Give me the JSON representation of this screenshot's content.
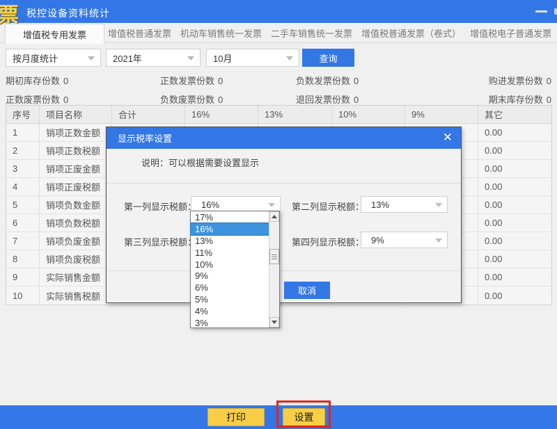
{
  "window": {
    "logo": "票",
    "title": "税控设备资料统计"
  },
  "tabs": {
    "active": "增值税专用发票",
    "items": [
      {
        "label": "增值税普通发票"
      },
      {
        "label": "机动车销售统一发票"
      },
      {
        "label": "二手车销售统一发票"
      },
      {
        "label": "增值税普通发票（卷式）"
      },
      {
        "label": "增值税电子普通发票"
      }
    ]
  },
  "filters": {
    "period": "按月度统计",
    "year": "2021年",
    "month": "10月",
    "query_label": "查询"
  },
  "stats": [
    {
      "label": "期初库存份数",
      "value": "0"
    },
    {
      "label": "正数发票份数",
      "value": "0"
    },
    {
      "label": "负数发票份数",
      "value": "0"
    },
    {
      "label": "购进发票份数",
      "value": "0"
    },
    {
      "label": "正数废票份数",
      "value": "0"
    },
    {
      "label": "负数废票份数",
      "value": "0"
    },
    {
      "label": "退回发票份数",
      "value": "0"
    },
    {
      "label": "期末库存份数",
      "value": "0"
    }
  ],
  "table": {
    "headers": [
      "序号",
      "项目名称",
      "合计",
      "16%",
      "13%",
      "10%",
      "9%",
      "其它"
    ],
    "rows": [
      {
        "no": "1",
        "name": "销项正数金额",
        "other": "0.00"
      },
      {
        "no": "2",
        "name": "销项正数税额",
        "other": "0.00"
      },
      {
        "no": "3",
        "name": "销项正废金额",
        "other": "0.00"
      },
      {
        "no": "4",
        "name": "销项正废税额",
        "other": "0.00"
      },
      {
        "no": "5",
        "name": "销项负数金额",
        "other": "0.00"
      },
      {
        "no": "6",
        "name": "销项负数税额",
        "other": "0.00"
      },
      {
        "no": "7",
        "name": "销项负废金额",
        "other": "0.00"
      },
      {
        "no": "8",
        "name": "销项负废税额",
        "other": "0.00"
      },
      {
        "no": "9",
        "name": "实际销售金额",
        "other": "0.00"
      },
      {
        "no": "10",
        "name": "实际销售税额",
        "other": "0.00"
      }
    ]
  },
  "modal": {
    "title": "显示税率设置",
    "close": "✕",
    "note": "说明：可以根据需要设置显示",
    "field1_label": "第一列显示税额：",
    "field1_value": "16%",
    "field2_label": "第二列显示税额：",
    "field2_value": "13%",
    "field3_label": "第三列显示税额：",
    "field4_label": "第四列显示税额：",
    "field4_value": "9%",
    "cancel_label": "取消"
  },
  "dropdown": {
    "selected": "16%",
    "options": [
      "17%",
      "16%",
      "13%",
      "11%",
      "10%",
      "9%",
      "6%",
      "5%",
      "4%",
      "3%"
    ]
  },
  "footer": {
    "print_label": "打印",
    "settings_label": "设置"
  },
  "colors": {
    "accent_blue": "#3377e6",
    "selection_blue": "#3d94de",
    "button_yellow": "#f8ce46",
    "annotation_red": "#e0261d",
    "logo_gold": "#f7d353"
  }
}
